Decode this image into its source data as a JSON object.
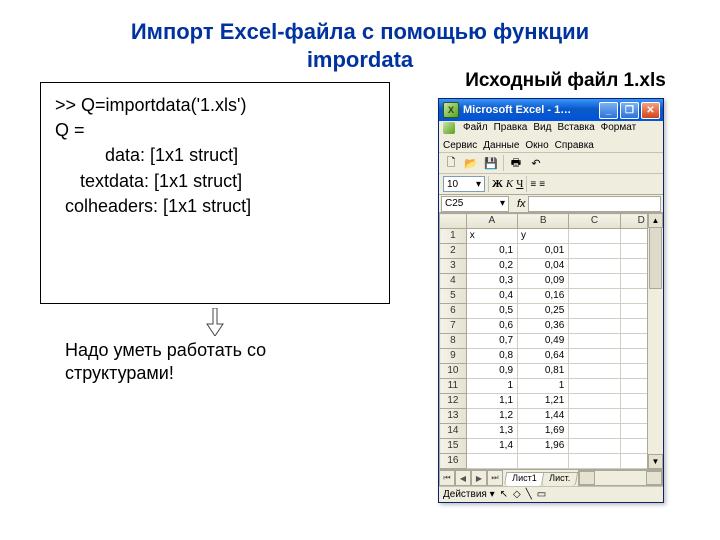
{
  "title_line1": "Импорт Excel-файла с помощью функции",
  "title_line2": "impordata",
  "code": {
    "l1": ">> Q=importdata('1.xls')",
    "l2": "",
    "l3": "Q = ",
    "l4": "",
    "l5": "          data: [1x1 struct]",
    "l6": "     textdata: [1x1 struct]",
    "l7": "  colheaders: [1x1 struct]"
  },
  "note": "Надо уметь работать со структурами!",
  "file_label": "Исходный файл 1.xls",
  "excel": {
    "titlebar": "Microsoft Excel - 1…",
    "menu": [
      "Файл",
      "Правка",
      "Вид",
      "Вставка",
      "Формат",
      "Сервис",
      "Данные",
      "Окно",
      "Справка"
    ],
    "fontsize": "10",
    "fmt_b": "Ж",
    "fmt_i": "К",
    "fmt_u": "Ч",
    "namebox": "C25",
    "fx": "fx",
    "col_headers": [
      "A",
      "B",
      "C",
      "D"
    ],
    "rows": [
      {
        "n": "1",
        "a": "x",
        "b": "y",
        "c": "",
        "d": "",
        "txt": true
      },
      {
        "n": "2",
        "a": "0,1",
        "b": "0,01",
        "c": "",
        "d": ""
      },
      {
        "n": "3",
        "a": "0,2",
        "b": "0,04",
        "c": "",
        "d": ""
      },
      {
        "n": "4",
        "a": "0,3",
        "b": "0,09",
        "c": "",
        "d": ""
      },
      {
        "n": "5",
        "a": "0,4",
        "b": "0,16",
        "c": "",
        "d": ""
      },
      {
        "n": "6",
        "a": "0,5",
        "b": "0,25",
        "c": "",
        "d": ""
      },
      {
        "n": "7",
        "a": "0,6",
        "b": "0,36",
        "c": "",
        "d": ""
      },
      {
        "n": "8",
        "a": "0,7",
        "b": "0,49",
        "c": "",
        "d": ""
      },
      {
        "n": "9",
        "a": "0,8",
        "b": "0,64",
        "c": "",
        "d": ""
      },
      {
        "n": "10",
        "a": "0,9",
        "b": "0,81",
        "c": "",
        "d": ""
      },
      {
        "n": "11",
        "a": "1",
        "b": "1",
        "c": "",
        "d": ""
      },
      {
        "n": "12",
        "a": "1,1",
        "b": "1,21",
        "c": "",
        "d": ""
      },
      {
        "n": "13",
        "a": "1,2",
        "b": "1,44",
        "c": "",
        "d": ""
      },
      {
        "n": "14",
        "a": "1,3",
        "b": "1,69",
        "c": "",
        "d": ""
      },
      {
        "n": "15",
        "a": "1,4",
        "b": "1,96",
        "c": "",
        "d": ""
      },
      {
        "n": "16",
        "a": "",
        "b": "",
        "c": "",
        "d": "",
        "txt": true
      }
    ],
    "tabs": [
      "Лист1",
      "Лист."
    ],
    "actions_label": "Действия"
  }
}
